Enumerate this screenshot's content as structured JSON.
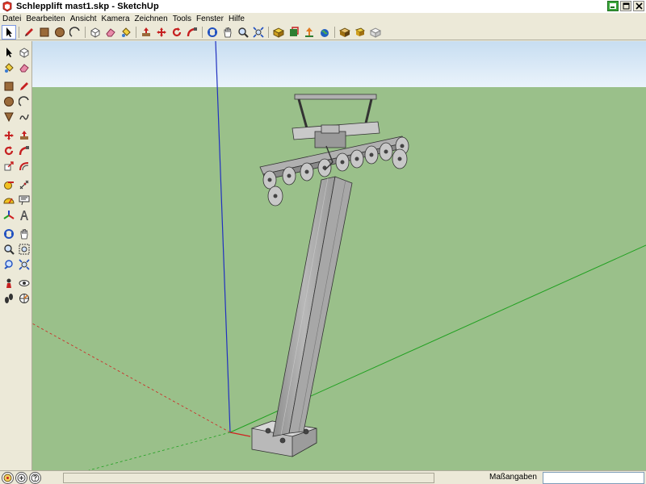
{
  "window": {
    "title": "Schlepplift mast1.skp - SketchUp",
    "app_icon": "sketchup-logo-icon",
    "buttons": [
      "minimize-icon",
      "maximize-icon",
      "close-icon"
    ]
  },
  "menu": {
    "items": [
      "Datei",
      "Bearbeiten",
      "Ansicht",
      "Kamera",
      "Zeichnen",
      "Tools",
      "Fenster",
      "Hilfe"
    ]
  },
  "toolbar_top": {
    "groups": [
      [
        "select-icon"
      ],
      [
        "pencil-icon",
        "rectangle-icon",
        "circle-icon",
        "arc-icon"
      ],
      [
        "make-component-icon",
        "eraser-icon",
        "paint-bucket-icon"
      ],
      [
        "push-pull-icon",
        "move-icon",
        "rotate-icon",
        "follow-me-icon"
      ],
      [
        "orbit-icon",
        "pan-icon",
        "zoom-icon",
        "zoom-extents-icon"
      ],
      [
        "get-models-icon",
        "share-model-icon",
        "share-component-icon",
        "google-earth-icon"
      ],
      [
        "preview-icon",
        "snapshot-icon",
        "toggle-terrain-icon"
      ]
    ]
  },
  "toolbar_left": {
    "rows": [
      [
        "select-icon",
        "make-component-icon"
      ],
      [
        "paint-bucket-icon",
        "eraser-icon"
      ],
      [
        "rectangle-icon",
        "line-icon"
      ],
      [
        "circle-icon",
        "arc-icon"
      ],
      [
        "polygon-icon",
        "freehand-icon"
      ],
      [
        "move-icon",
        "push-pull-icon"
      ],
      [
        "rotate-icon",
        "follow-me-icon"
      ],
      [
        "scale-icon",
        "offset-icon"
      ],
      [
        "tape-measure-icon",
        "dimension-icon"
      ],
      [
        "protractor-icon",
        "text-icon"
      ],
      [
        "axes-icon",
        "3d-text-icon"
      ],
      [
        "orbit-icon",
        "pan-icon"
      ],
      [
        "zoom-icon",
        "zoom-window-icon"
      ],
      [
        "previous-view-icon",
        "zoom-extents-icon"
      ],
      [
        "position-camera-icon",
        "look-around-icon"
      ],
      [
        "walk-icon",
        "section-plane-icon"
      ]
    ]
  },
  "viewport": {
    "sky_color": "#ffffff",
    "ground_color": "#9ac08a",
    "axis_colors": {
      "red": "#d02020",
      "green": "#20a020",
      "blue": "#2030c0"
    }
  },
  "statusbar": {
    "icons": [
      "geo-location-icon",
      "credits-icon",
      "help-icon"
    ],
    "hint_text": "",
    "measure_label": "Maßangaben",
    "measure_value": ""
  }
}
